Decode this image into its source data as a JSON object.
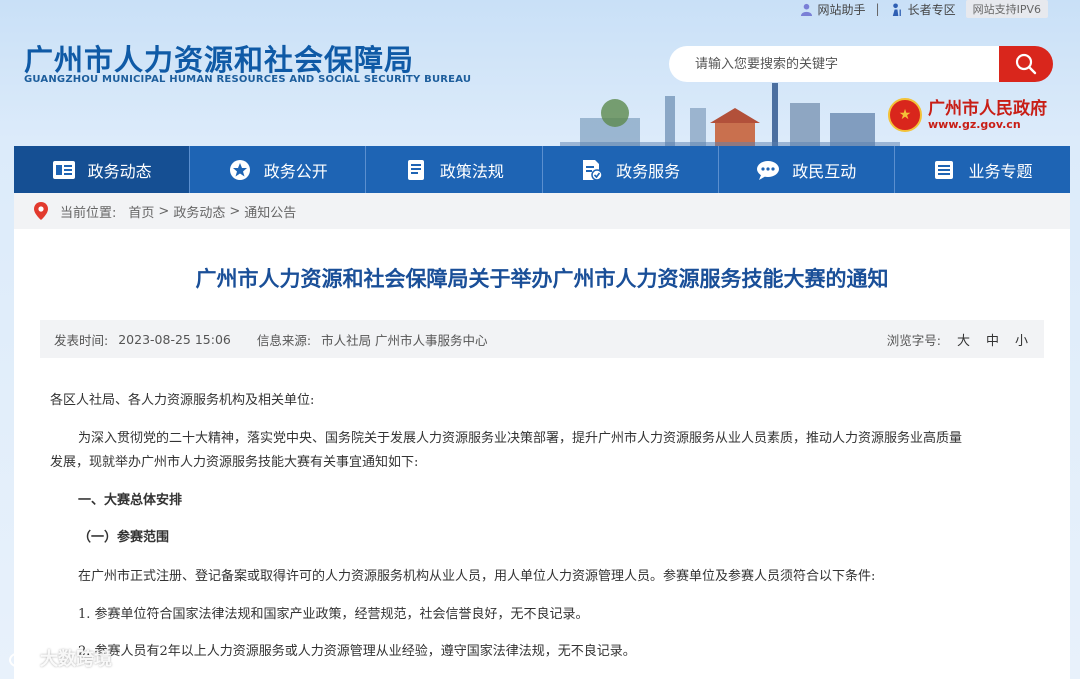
{
  "topbar": {
    "assistant_label": "网站助手",
    "separator": "|",
    "elderly_label": "长者专区",
    "ipv6_label": "网站支持IPV6"
  },
  "header": {
    "title_cn": "广州市人力资源和社会保障局",
    "title_en": "GUANGZHOU MUNICIPAL HUMAN RESOURCES AND SOCIAL SECURITY BUREAU",
    "search_placeholder": "请输入您要搜索的关键字",
    "gov_name": "广州市人民政府",
    "gov_url": "www.gz.gov.cn"
  },
  "nav": {
    "items": [
      {
        "label": "政务动态",
        "icon": "newspaper-icon"
      },
      {
        "label": "政务公开",
        "icon": "star-icon"
      },
      {
        "label": "政策法规",
        "icon": "book-icon"
      },
      {
        "label": "政务服务",
        "icon": "document-check-icon"
      },
      {
        "label": "政民互动",
        "icon": "chat-bubble-icon"
      },
      {
        "label": "业务专题",
        "icon": "list-icon"
      }
    ],
    "active_index": 0
  },
  "breadcrumb": {
    "prefix": "当前位置:",
    "home": "首页",
    "sep": ">",
    "section": "政务动态",
    "page": "通知公告"
  },
  "article": {
    "title": "广州市人力资源和社会保障局关于举办广州市人力资源服务技能大赛的通知",
    "publish_label": "发表时间:",
    "publish_time": "2023-08-25 15:06",
    "source_label": "信息来源:",
    "source": "市人社局 广州市人事服务中心",
    "fontsize_label": "浏览字号:",
    "size_large": "大",
    "size_medium": "中",
    "size_small": "小",
    "paragraphs": {
      "p0": "各区人社局、各人力资源服务机构及相关单位:",
      "p1a": "为深入贯彻党的二十大精神，落实党中央、国务院关于发展人力资源服务业决策部署，提升广州市人力资源服务从业人员素质，推动人力资源服务业高质量",
      "p1b": "发展，现就举办广州市人力资源服务技能大赛有关事宜通知如下:",
      "h1": "一、大赛总体安排",
      "h2": "（一）参赛范围",
      "p2": "在广州市正式注册、登记备案或取得许可的人力资源服务机构从业人员，用人单位人力资源管理人员。参赛单位及参赛人员须符合以下条件:",
      "p3": "1. 参赛单位符合国家法律法规和国家产业政策，经营规范，社会信誉良好，无不良记录。",
      "p4": "2. 参赛人员有2年以上人力资源服务或人力资源管理从业经验，遵守国家法律法规，无不良记录。"
    }
  },
  "watermark": {
    "text": "大数跨境"
  }
}
